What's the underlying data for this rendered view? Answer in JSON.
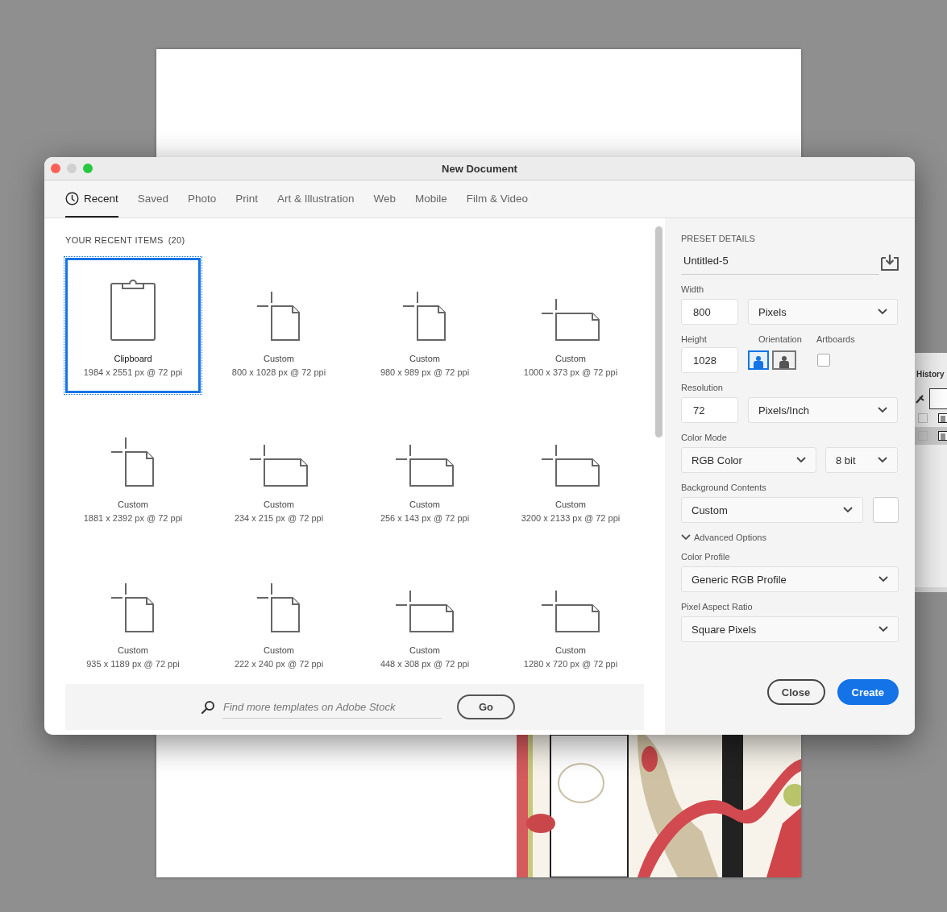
{
  "history_panel": {
    "title": "History",
    "steps": [
      {
        "checked": false,
        "selected": false
      },
      {
        "checked": false,
        "selected": true
      }
    ]
  },
  "dialog": {
    "title": "New Document"
  },
  "tabs": [
    {
      "label": "Recent",
      "selected": true,
      "kind": "clock"
    },
    {
      "label": "Saved",
      "selected": false,
      "kind": "plain"
    },
    {
      "label": "Photo",
      "selected": false,
      "kind": "plain"
    },
    {
      "label": "Print",
      "selected": false,
      "kind": "plain"
    },
    {
      "label": "Art & Illustration",
      "selected": false,
      "kind": "plain"
    },
    {
      "label": "Web",
      "selected": false,
      "kind": "plain"
    },
    {
      "label": "Mobile",
      "selected": false,
      "kind": "plain"
    },
    {
      "label": "Film & Video",
      "selected": false,
      "kind": "plain"
    }
  ],
  "recent": {
    "heading": "YOUR RECENT ITEMS",
    "count": "(20)",
    "items": [
      {
        "name": "Clipboard",
        "details": "1984 x 2551 px @ 72 ppi",
        "kind": "clipboard",
        "selected": true
      },
      {
        "name": "Custom",
        "details": "800 x 1028 px @ 72 ppi",
        "kind": "portrait",
        "selected": false
      },
      {
        "name": "Custom",
        "details": "980 x 989 px @ 72 ppi",
        "kind": "portrait",
        "selected": false
      },
      {
        "name": "Custom",
        "details": "1000 x 373 px @ 72 ppi",
        "kind": "landscape",
        "selected": false
      },
      {
        "name": "Custom",
        "details": "1881 x 2392 px @ 72 ppi",
        "kind": "portrait",
        "selected": false
      },
      {
        "name": "Custom",
        "details": "234 x 215 px @ 72 ppi",
        "kind": "landscape",
        "selected": false
      },
      {
        "name": "Custom",
        "details": "256 x 143 px @ 72 ppi",
        "kind": "landscape",
        "selected": false
      },
      {
        "name": "Custom",
        "details": "3200 x 2133 px @ 72 ppi",
        "kind": "landscape",
        "selected": false
      },
      {
        "name": "Custom",
        "details": "935 x 1189 px @ 72 ppi",
        "kind": "portrait",
        "selected": false
      },
      {
        "name": "Custom",
        "details": "222 x 240 px @ 72 ppi",
        "kind": "portrait",
        "selected": false
      },
      {
        "name": "Custom",
        "details": "448 x 308 px @ 72 ppi",
        "kind": "landscape",
        "selected": false
      },
      {
        "name": "Custom",
        "details": "1280 x 720 px @ 72 ppi",
        "kind": "landscape",
        "selected": false
      }
    ]
  },
  "search": {
    "placeholder": "Find more templates on Adobe Stock",
    "button": "Go"
  },
  "preset": {
    "heading": "PRESET DETAILS",
    "name": "Untitled-5",
    "width": {
      "label": "Width",
      "value": "800",
      "unit": "Pixels"
    },
    "height": {
      "label": "Height",
      "value": "1028"
    },
    "orientation": {
      "label": "Orientation",
      "options": [
        {
          "kind": "portrait",
          "selected": true
        },
        {
          "kind": "landscape",
          "selected": false
        }
      ]
    },
    "artboards": {
      "label": "Artboards",
      "checked": false
    },
    "resolution": {
      "label": "Resolution",
      "value": "72",
      "unit": "Pixels/Inch"
    },
    "color_mode": {
      "label": "Color Mode",
      "value": "RGB Color",
      "depth": "8 bit"
    },
    "background": {
      "label": "Background Contents",
      "value": "Custom"
    },
    "advanced": {
      "label": "Advanced Options",
      "expanded": true
    },
    "color_profile": {
      "label": "Color Profile",
      "value": "Generic RGB Profile"
    },
    "pixel_aspect": {
      "label": "Pixel Aspect Ratio",
      "value": "Square Pixels"
    }
  },
  "buttons": [
    {
      "label": "Close",
      "kind": "secondary"
    },
    {
      "label": "Create",
      "kind": "primary"
    }
  ]
}
